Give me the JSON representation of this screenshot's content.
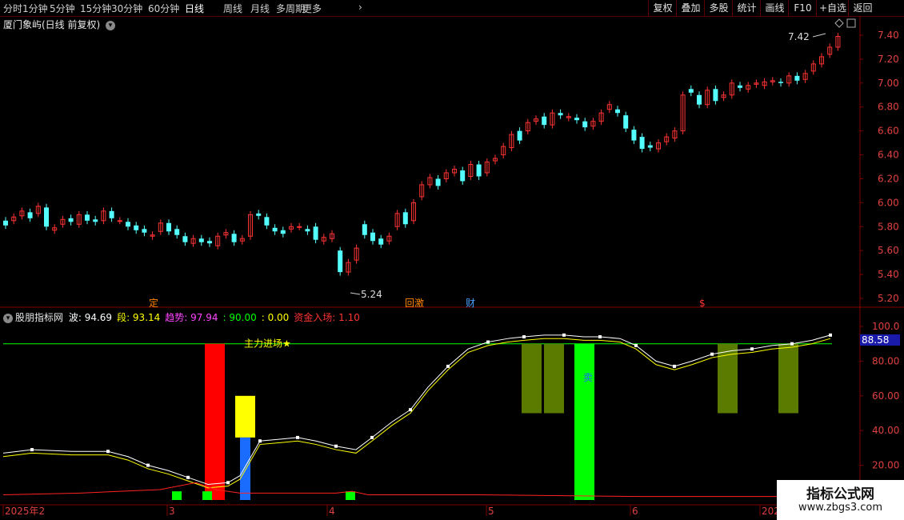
{
  "toolbar": {
    "periods": [
      "分时",
      "1分钟",
      "5分钟",
      "15分钟",
      "30分钟",
      "60分钟",
      "日线",
      "周线",
      "月线",
      "多周期",
      "更多"
    ],
    "active_period": "日线",
    "right_buttons": [
      "复权",
      "叠加",
      "多股",
      "统计",
      "画线",
      "F10",
      "+自选",
      "返回"
    ]
  },
  "price_panel": {
    "title": "厦门象屿(日线 前复权)",
    "high_label": "7.42",
    "low_label": "5.24",
    "y_ticks": [
      "7.40",
      "7.20",
      "7.00",
      "6.80",
      "6.60",
      "6.40",
      "6.20",
      "6.00",
      "5.80",
      "5.60",
      "5.40",
      "5.20"
    ],
    "y_tick_values": [
      7.4,
      7.2,
      7.0,
      6.8,
      6.6,
      6.4,
      6.2,
      6.0,
      5.8,
      5.6,
      5.4,
      5.2
    ],
    "markers": [
      {
        "text": "定",
        "color": "#ff8800"
      },
      {
        "text": "回激",
        "color": "#ff8800"
      },
      {
        "text": "财",
        "color": "#4aa0ff"
      },
      {
        "text": "$",
        "color": "#ff3333"
      }
    ],
    "candles": [
      [
        5.85,
        5.81
      ],
      [
        5.85,
        5.88
      ],
      [
        5.89,
        5.93
      ],
      [
        5.92,
        5.87
      ],
      [
        5.91,
        5.97
      ],
      [
        5.96,
        5.8
      ],
      [
        5.77,
        5.79
      ],
      [
        5.82,
        5.86
      ],
      [
        5.87,
        5.84
      ],
      [
        5.82,
        5.9
      ],
      [
        5.9,
        5.85
      ],
      [
        5.86,
        5.84
      ],
      [
        5.85,
        5.93
      ],
      [
        5.93,
        5.87
      ],
      [
        5.85,
        5.85
      ],
      [
        5.84,
        5.8
      ],
      [
        5.81,
        5.77
      ],
      [
        5.78,
        5.75
      ],
      [
        5.72,
        5.73
      ],
      [
        5.76,
        5.83
      ],
      [
        5.83,
        5.76
      ],
      [
        5.78,
        5.73
      ],
      [
        5.72,
        5.67
      ],
      [
        5.66,
        5.7
      ],
      [
        5.7,
        5.67
      ],
      [
        5.68,
        5.66
      ],
      [
        5.64,
        5.72
      ],
      [
        5.73,
        5.75
      ],
      [
        5.74,
        5.67
      ],
      [
        5.68,
        5.7
      ],
      [
        5.72,
        5.9
      ],
      [
        5.91,
        5.89
      ],
      [
        5.88,
        5.81
      ],
      [
        5.79,
        5.76
      ],
      [
        5.77,
        5.74
      ],
      [
        5.78,
        5.8
      ],
      [
        5.8,
        5.8
      ],
      [
        5.78,
        5.76
      ],
      [
        5.8,
        5.69
      ],
      [
        5.68,
        5.71
      ],
      [
        5.7,
        5.74
      ],
      [
        5.6,
        5.42
      ],
      [
        5.42,
        5.5
      ],
      [
        5.52,
        5.62
      ],
      [
        5.82,
        5.73
      ],
      [
        5.75,
        5.68
      ],
      [
        5.7,
        5.65
      ],
      [
        5.68,
        5.72
      ],
      [
        5.8,
        5.91
      ],
      [
        5.92,
        5.82
      ],
      [
        5.85,
        6.0
      ],
      [
        6.05,
        6.15
      ],
      [
        6.15,
        6.21
      ],
      [
        6.2,
        6.14
      ],
      [
        6.2,
        6.25
      ],
      [
        6.25,
        6.28
      ],
      [
        6.27,
        6.18
      ],
      [
        6.22,
        6.32
      ],
      [
        6.32,
        6.22
      ],
      [
        6.25,
        6.34
      ],
      [
        6.35,
        6.37
      ],
      [
        6.4,
        6.47
      ],
      [
        6.46,
        6.57
      ],
      [
        6.6,
        6.52
      ],
      [
        6.6,
        6.67
      ],
      [
        6.68,
        6.7
      ],
      [
        6.72,
        6.65
      ],
      [
        6.65,
        6.75
      ],
      [
        6.75,
        6.73
      ],
      [
        6.71,
        6.72
      ],
      [
        6.71,
        6.69
      ],
      [
        6.68,
        6.63
      ],
      [
        6.64,
        6.68
      ],
      [
        6.68,
        6.75
      ],
      [
        6.78,
        6.82
      ],
      [
        6.78,
        6.75
      ],
      [
        6.73,
        6.62
      ],
      [
        6.61,
        6.52
      ],
      [
        6.55,
        6.45
      ],
      [
        6.48,
        6.46
      ],
      [
        6.45,
        6.5
      ],
      [
        6.51,
        6.55
      ],
      [
        6.54,
        6.6
      ],
      [
        6.6,
        6.9
      ],
      [
        6.95,
        6.92
      ],
      [
        6.9,
        6.82
      ],
      [
        6.82,
        6.94
      ],
      [
        6.95,
        6.85
      ],
      [
        6.88,
        6.9
      ],
      [
        6.9,
        7.0
      ],
      [
        6.98,
        6.96
      ],
      [
        6.95,
        6.98
      ],
      [
        6.99,
        7.0
      ],
      [
        6.98,
        7.01
      ],
      [
        7.01,
        7.02
      ],
      [
        7.01,
        7.0
      ],
      [
        7.0,
        7.06
      ],
      [
        7.06,
        7.02
      ],
      [
        7.03,
        7.08
      ],
      [
        7.1,
        7.16
      ],
      [
        7.16,
        7.22
      ],
      [
        7.24,
        7.3
      ],
      [
        7.3,
        7.39
      ]
    ]
  },
  "indicator_panel": {
    "name": "股朋指标网",
    "legend": [
      {
        "label": "波: ",
        "value": "94.69",
        "color": "#ffffff"
      },
      {
        "label": "段: ",
        "value": "93.14",
        "color": "#ffff00"
      },
      {
        "label": "趋势: ",
        "value": "97.94",
        "color": "#ff44ff"
      },
      {
        "label": ": ",
        "value": "90.00",
        "color": "#00ff00"
      },
      {
        "label": ": ",
        "value": "0.00",
        "color": "#ffff00"
      },
      {
        "label": "资金入场: ",
        "value": "1.10",
        "color": "#ff3333"
      }
    ],
    "y_ticks": [
      "100.0",
      "80.00",
      "60.00",
      "40.00",
      "20.00"
    ],
    "y_tick_values": [
      100,
      80,
      60,
      40,
      20
    ],
    "current_value": "88.58",
    "line90_label": "主力进场★",
    "sell_label": "卖"
  },
  "date_axis": {
    "labels": [
      "2025年2",
      "3",
      "4",
      "5",
      "6",
      "202"
    ]
  },
  "watermark": {
    "line1": "指标公式网",
    "line2": "www.zbgs3.com"
  },
  "colors": {
    "up": "#ff3333",
    "down": "#54ffff",
    "grid_line": "#800000",
    "white_line": "#ffffff",
    "yellow_line": "#ffff00",
    "red_line": "#ff2222",
    "bar_red": "#ff0000",
    "bar_yellow": "#ffff00",
    "bar_blue": "#1a6cff",
    "bar_green": "#00ff00",
    "bar_olive": "#5a7a00"
  }
}
